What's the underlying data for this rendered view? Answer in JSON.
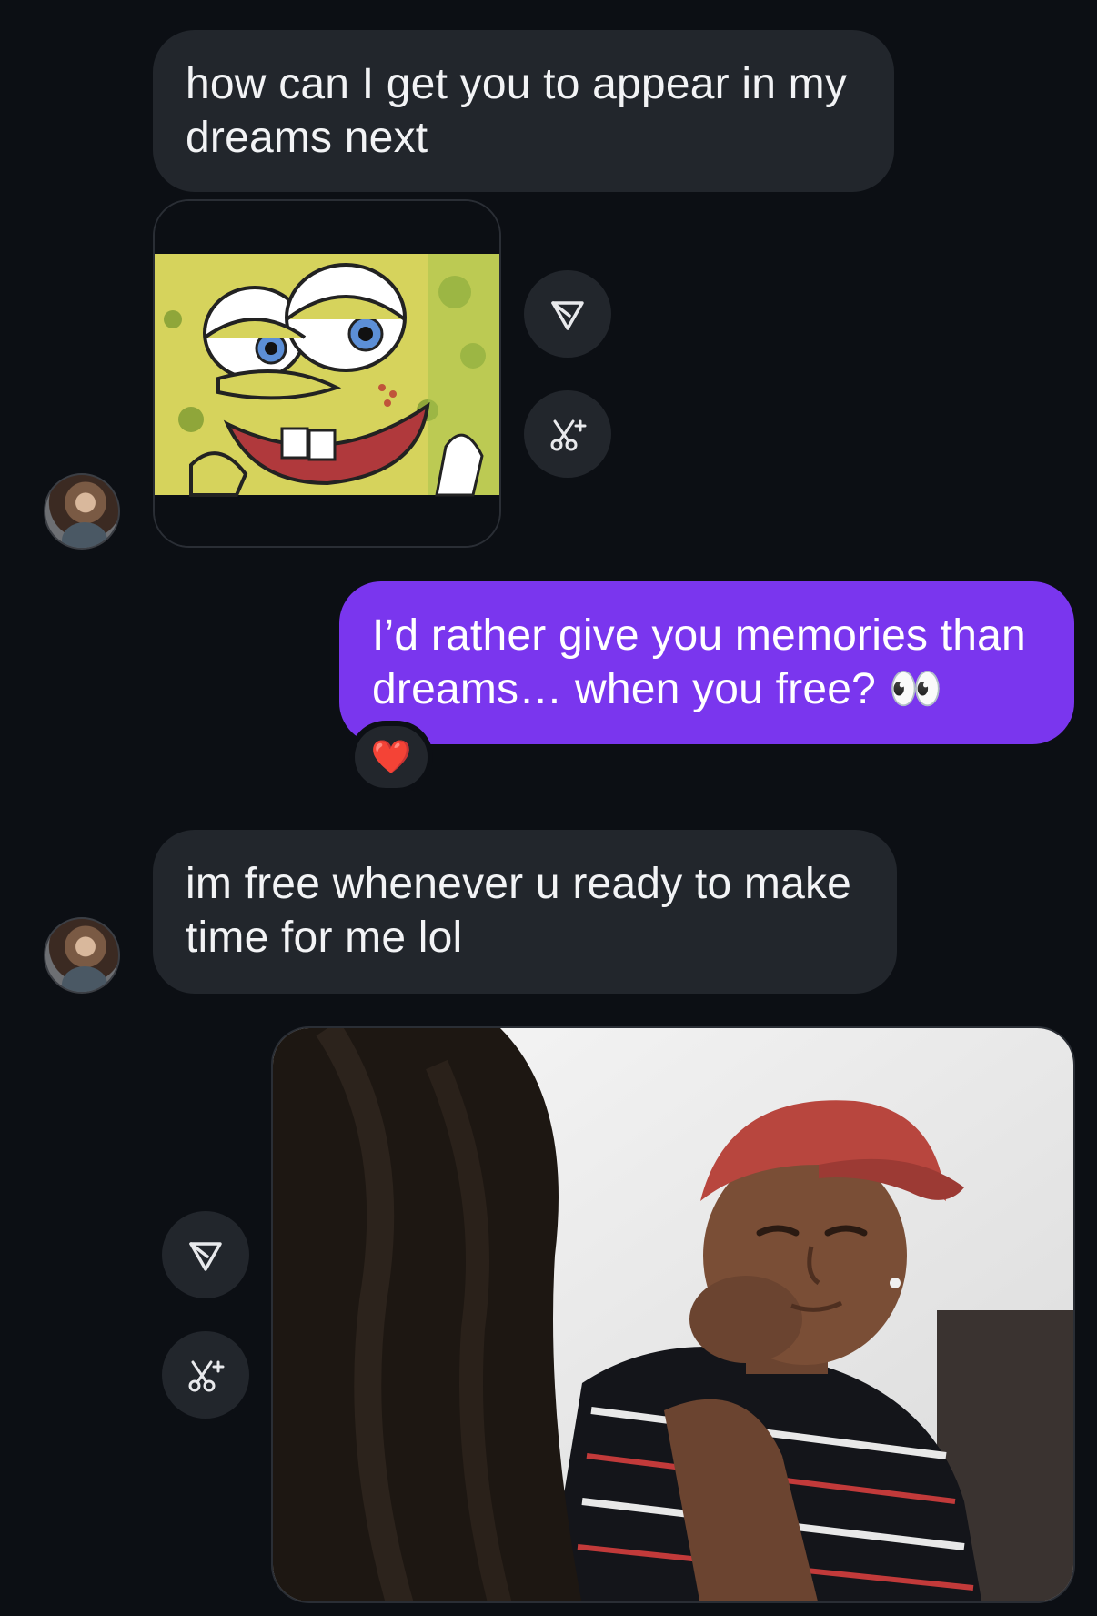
{
  "conversation": {
    "messages": [
      {
        "direction": "incoming",
        "type": "text",
        "text": "how can I get you to appear in my dreams next"
      },
      {
        "direction": "incoming",
        "type": "image",
        "image_label": "SpongeBob laughing meme"
      },
      {
        "direction": "outgoing",
        "type": "text",
        "text": "I’d rather give you memories than dreams… when you free? 👀",
        "reaction": "❤️"
      },
      {
        "direction": "incoming",
        "type": "text",
        "text": "im free whenever u ready to make time for me lol"
      },
      {
        "direction": "outgoing",
        "type": "image",
        "image_label": "Man in red cap resting chin on hand"
      }
    ]
  },
  "actions": {
    "share_icon": "share-icon",
    "ai_edit_icon": "scissors-sparkle-icon"
  },
  "colors": {
    "background": "#0c0f14",
    "incoming_bubble": "#22262c",
    "outgoing_bubble": "#7a36ee",
    "text": "#f2f3f5"
  }
}
